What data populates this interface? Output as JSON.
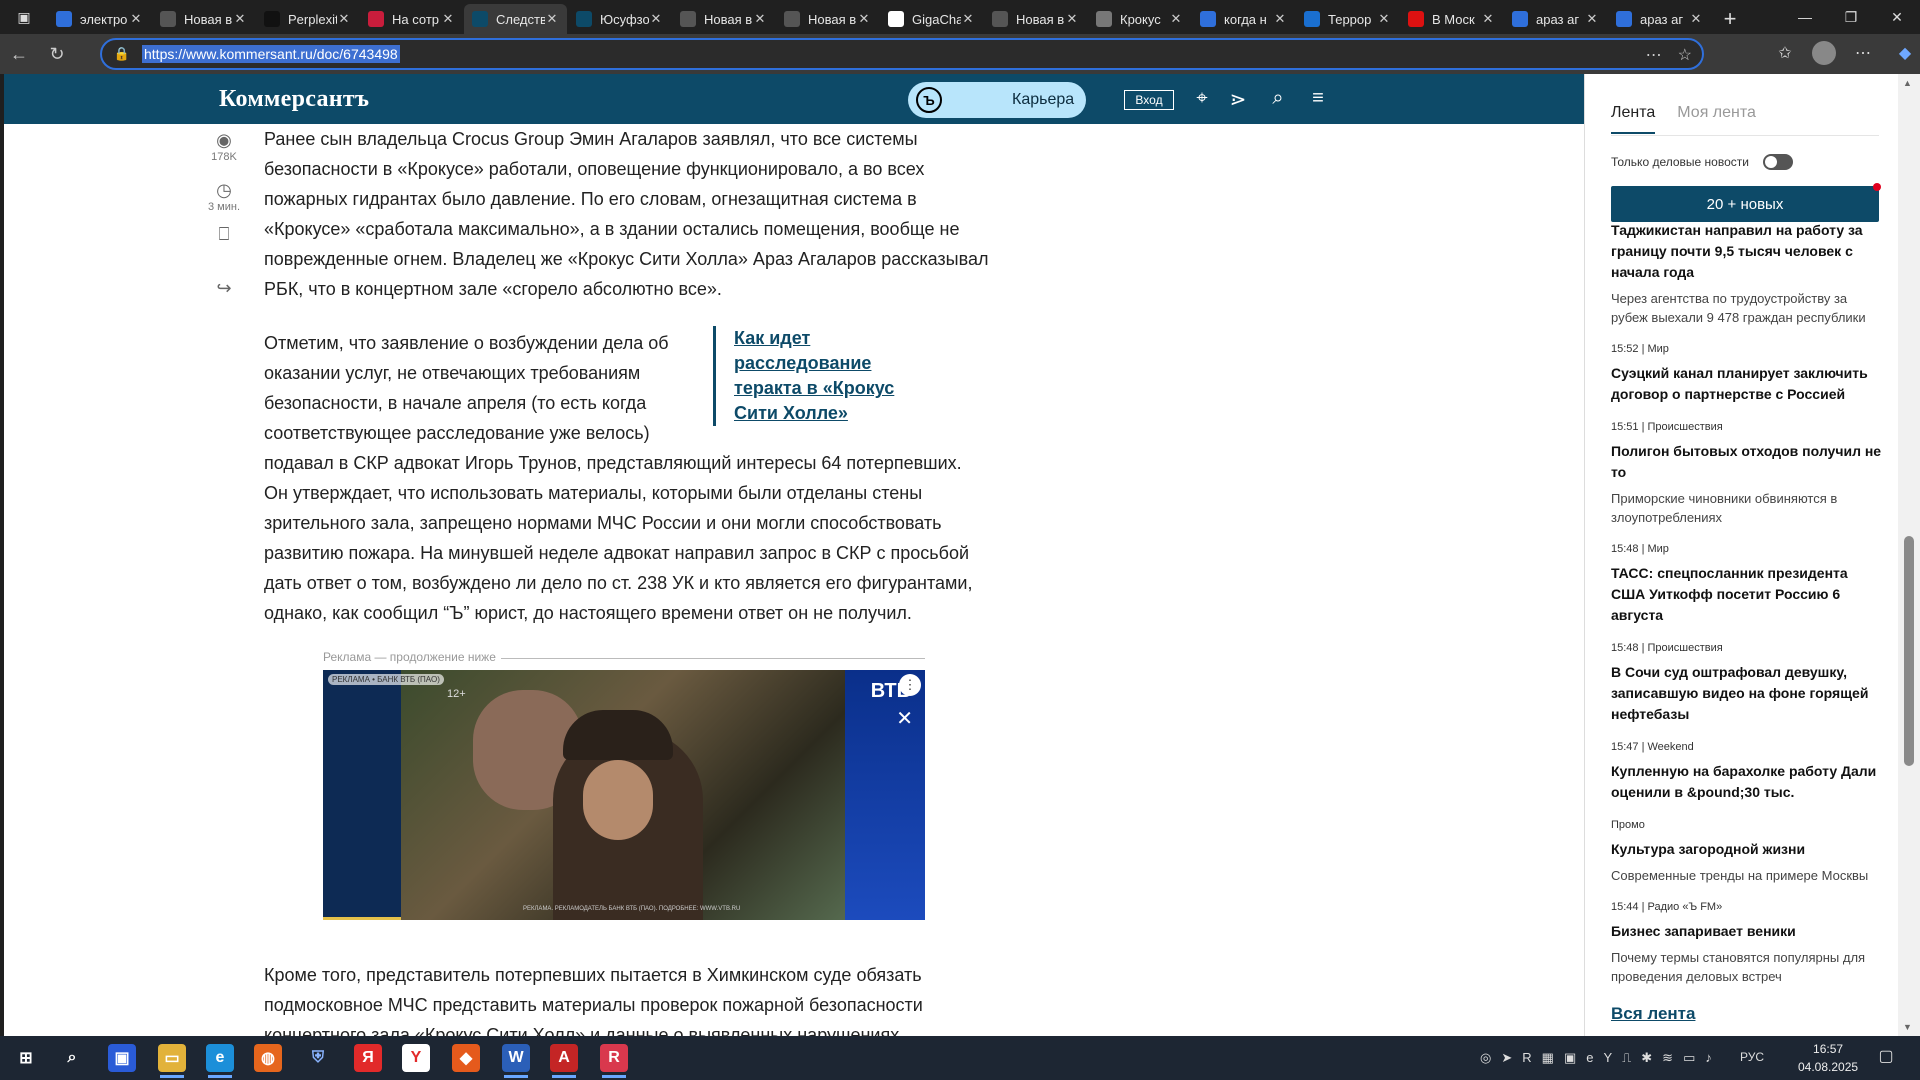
{
  "tabs": [
    {
      "title": "электро",
      "icon": "search-icon",
      "color": "#2f6fdb"
    },
    {
      "title": "Новая вкладка",
      "icon": "newtab-icon",
      "color": "#555"
    },
    {
      "title": "Perplexity",
      "icon": "perplexity-icon",
      "color": "#111"
    },
    {
      "title": "На сотр",
      "icon": "r-icon",
      "color": "#c91d3c"
    },
    {
      "title": "Следств",
      "icon": "kommersant-icon",
      "color": "#0d4a68",
      "active": true
    },
    {
      "title": "Юсуфзо",
      "icon": "kommersant-icon",
      "color": "#0d4a68"
    },
    {
      "title": "Новая вкладка",
      "icon": "newtab-icon",
      "color": "#555"
    },
    {
      "title": "Новая вкладка",
      "icon": "newtab-icon",
      "color": "#555"
    },
    {
      "title": "GigaChat",
      "icon": "gigachat-icon",
      "color": "#fff"
    },
    {
      "title": "Новая вкладка",
      "icon": "newtab-icon",
      "color": "#555"
    },
    {
      "title": "Крокус",
      "icon": "globe-icon",
      "color": "#777"
    },
    {
      "title": "когда н",
      "icon": "search-icon",
      "color": "#2f6fdb"
    },
    {
      "title": "Террор",
      "icon": "b-icon",
      "color": "#1a6fd0"
    },
    {
      "title": "В Моск",
      "icon": "rbc-icon",
      "color": "#d11"
    },
    {
      "title": "араз аг",
      "icon": "search-icon",
      "color": "#2f6fdb"
    },
    {
      "title": "араз аг",
      "icon": "search-icon",
      "color": "#2f6fdb"
    }
  ],
  "browser": {
    "url": "https://www.kommersant.ru/doc/6743498"
  },
  "site": {
    "logo": "Коммерсантъ",
    "career": "Карьера",
    "login": "Вход"
  },
  "meta": {
    "views": "178K",
    "read_time": "3 мин."
  },
  "article": {
    "p1": [
      "Ранее сын владельца Crocus Group Эмин Агаларов заявлял, что все системы",
      "безопасности в «Крокусе» работали, оповещение функционировало, а во всех",
      "пожарных гидрантах было давление. По его словам, огнезащитная система в",
      "«Крокусе» «сработала максимально», а в здании остались помещения, вообще не",
      "поврежденные огнем. Владелец же «Крокус Сити Холла» Араз Агаларов рассказывал",
      "РБК, что в концертном зале «сгорело абсолютно все»."
    ],
    "p2_narrow": [
      "Отметим, что заявление о возбуждении дела об",
      "оказании услуг, не отвечающих требованиям",
      "безопасности, в начале апреля (то есть когда",
      "соответствующее расследование уже велось)"
    ],
    "p2_wide": [
      "подавал в СКР адвокат Игорь Трунов, представляющий интересы 64 потерпевших.",
      "Он утверждает, что использовать материалы, которыми были отделаны стены",
      "зрительного зала, запрещено нормами МЧС России и они могли способствовать",
      "развитию пожара. На минувшей неделе адвокат направил запрос в СКР с просьбой",
      "дать ответ о том, возбуждено ли дело по ст. 238 УК и кто является его фигурантами,",
      "однако, как сообщил “Ъ” юрист, до настоящего времени ответ он не получил."
    ],
    "inset_link": "Как идет расследование теракта в «Крокус Сити Холле»",
    "p3": [
      "Кроме того, представитель потерпевших пытается в Химкинском суде обязать",
      "подмосковное МЧС представить материалы проверок пожарной безопасности",
      "концертного зала «Крокус Сити Холл» и данные о выявленных нарушениях"
    ]
  },
  "ad": {
    "label": "Реклама — продолжение ниже",
    "tag": "РЕКЛАМА • БАНК ВТБ (ПАО)",
    "age": "12+",
    "brand": "ВТБ",
    "footer": "РЕКЛАМА. РЕКЛАМОДАТЕЛЬ БАНК ВТБ (ПАО). ПОДРОБНЕЕ: WWW.VTB.RU"
  },
  "feed": {
    "tab_active": "Лента",
    "tab_other": "Моя лента",
    "only_business": "Только деловые новости",
    "new_button": "20 + новых",
    "items": [
      {
        "meta": "",
        "headline": "Таджикистан направил на работу за границу почти 9,5 тысяч человек с начала года",
        "sub": "Через агентства по трудоустройству за рубеж выехали 9 478 граждан республики"
      },
      {
        "meta": "15:52 | Мир",
        "headline": "Суэцкий канал планирует заключить договор о партнерстве с Россией",
        "sub": ""
      },
      {
        "meta": "15:51 | Происшествия",
        "headline": "Полигон бытовых отходов получил не то",
        "sub": "Приморские чиновники обвиняются в злоупотреблениях"
      },
      {
        "meta": "15:48 | Мир",
        "headline": "ТАСС: спецпосланник президента США Уиткофф посетит Россию 6 августа",
        "sub": ""
      },
      {
        "meta": "15:48 | Происшествия",
        "headline": "В Сочи суд оштрафовал девушку, записавшую видео на фоне горящей нефтебазы",
        "sub": ""
      },
      {
        "meta": "15:47 | Weekend",
        "headline": "Купленную на барахолке работу Дали оценили в &pound;30 тыс.",
        "sub": ""
      },
      {
        "meta": "Промо",
        "headline": "Культура загородной жизни",
        "sub": "Современные тренды на примере Москвы"
      },
      {
        "meta": "15:44 | Радио «Ъ FM»",
        "headline": "Бизнес запаривает веники",
        "sub": "Почему термы становятся популярны для проведения деловых встреч"
      }
    ],
    "all_feed": "Вся лента"
  },
  "taskbar": {
    "lang": "РУС",
    "time": "16:57",
    "date": "04.08.2025"
  }
}
